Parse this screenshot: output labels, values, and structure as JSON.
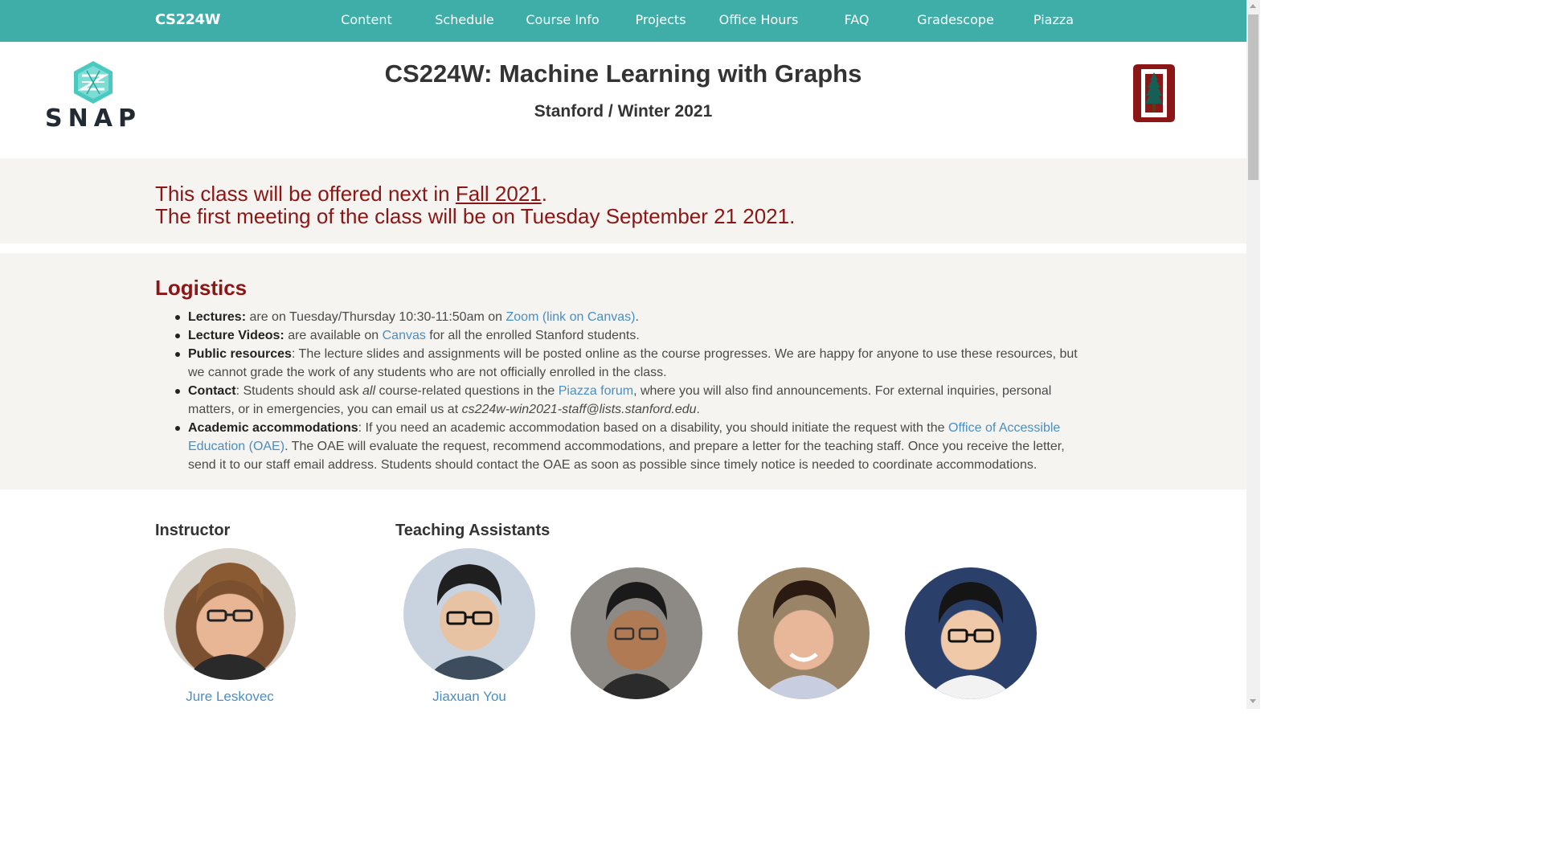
{
  "nav": {
    "brand": "CS224W",
    "items": [
      {
        "label": "Content"
      },
      {
        "label": "Schedule"
      },
      {
        "label": "Course Info"
      },
      {
        "label": "Projects"
      },
      {
        "label": "Office Hours"
      },
      {
        "label": "FAQ"
      },
      {
        "label": "Gradescope"
      },
      {
        "label": "Piazza"
      }
    ]
  },
  "header": {
    "logo_text": "SNAP",
    "title": "CS224W: Machine Learning with Graphs",
    "subtitle": "Stanford / Winter 2021"
  },
  "announcement": {
    "line1_prefix": "This class will be offered next in ",
    "line1_link": "Fall 2021",
    "line1_suffix": ".",
    "line2": "The first meeting of the class will be on Tuesday September 21 2021."
  },
  "logistics": {
    "heading": "Logistics",
    "lectures": {
      "label": "Lectures:",
      "text": " are on Tuesday/Thursday 10:30-11:50am on ",
      "link": "Zoom (link on Canvas)",
      "end": "."
    },
    "videos": {
      "label": "Lecture Videos:",
      "text": " are available on ",
      "link": "Canvas",
      "end": " for all the enrolled Stanford students."
    },
    "public": {
      "label": "Public resources",
      "text": ": The lecture slides and assignments will be posted online as the course progresses. We are happy for anyone to use these resources, but we cannot grade the work of any students who are not officially enrolled in the class."
    },
    "contact": {
      "label": "Contact",
      "text1": ": Students should ask ",
      "emph": "all",
      "text2": " course-related questions in the ",
      "link": "Piazza forum",
      "text3": ", where you will also find announcements. For external inquiries, personal matters, or in emergencies, you can email us at ",
      "email": "cs224w-win2021-staff@lists.stanford.edu",
      "end": "."
    },
    "accommodations": {
      "label": "Academic accommodations",
      "text1": ": If you need an academic accommodation based on a disability, you should initiate the request with the ",
      "link": "Office of Accessible Education (OAE)",
      "text2": ". The OAE will evaluate the request, recommend accommodations, and prepare a letter for the teaching staff. Once you receive the letter, send it to our staff email address. Students should contact the OAE as soon as possible since timely notice is needed to coordinate accommodations."
    }
  },
  "people": {
    "instructor_heading": "Instructor",
    "ta_heading": "Teaching Assistants",
    "instructor": {
      "name": "Jure Leskovec"
    },
    "tas": [
      {
        "name": "Jiaxuan You"
      }
    ]
  },
  "colors": {
    "nav_bg": "#3fada8",
    "cardinal": "#8c1515",
    "link": "#4a8ec2",
    "section_bg": "#f5f4f0"
  }
}
